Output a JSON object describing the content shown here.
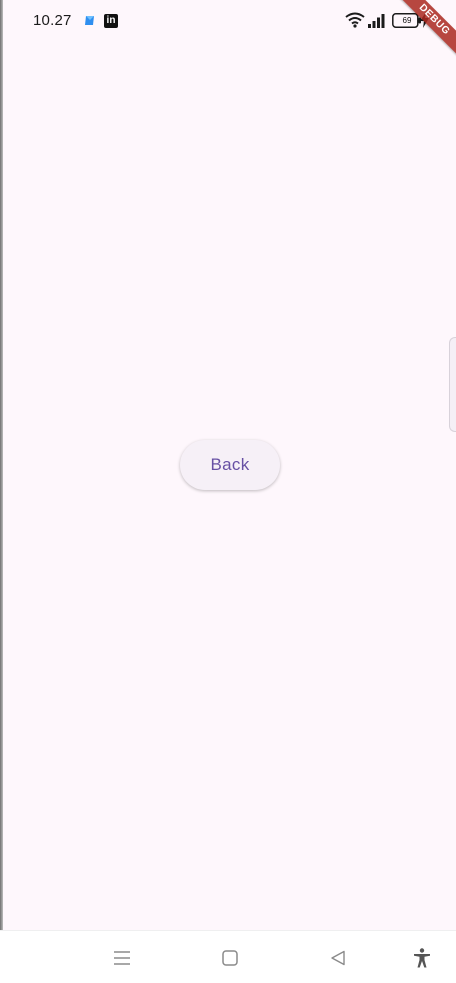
{
  "status_bar": {
    "time": "10.27",
    "battery_level": "69",
    "icons": [
      "app-icon-blue",
      "linkedin-icon",
      "wifi-icon",
      "signal-icon",
      "battery-icon",
      "charging-icon"
    ],
    "linkedin_glyph": "in"
  },
  "debug_banner": {
    "label": "DEBUG"
  },
  "main": {
    "back_button_label": "Back"
  },
  "nav_bar": {
    "icons": [
      "menu-icon",
      "home-icon",
      "back-icon",
      "accessibility-icon"
    ]
  },
  "colors": {
    "background": "#fef7fc",
    "button_text": "#6750a4",
    "button_bg": "#f6f0f7",
    "debug_banner": "#aa281e"
  }
}
